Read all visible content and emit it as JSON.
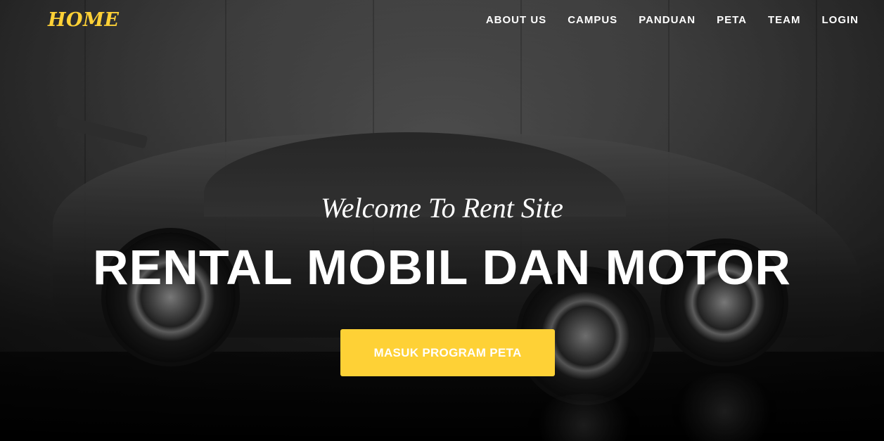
{
  "nav": {
    "brand": "HOME",
    "items": [
      {
        "label": "ABOUT US"
      },
      {
        "label": "CAMPUS"
      },
      {
        "label": "PANDUAN"
      },
      {
        "label": "PETA"
      },
      {
        "label": "TEAM"
      },
      {
        "label": "LOGIN"
      }
    ]
  },
  "hero": {
    "lead": "Welcome To Rent Site",
    "heading": "RENTAL MOBIL DAN MOTOR",
    "button_label": "MASUK PROGRAM PETA",
    "background_image": "car-and-motorcycle-photo"
  },
  "colors": {
    "accent": "#fed136",
    "text": "#ffffff"
  }
}
